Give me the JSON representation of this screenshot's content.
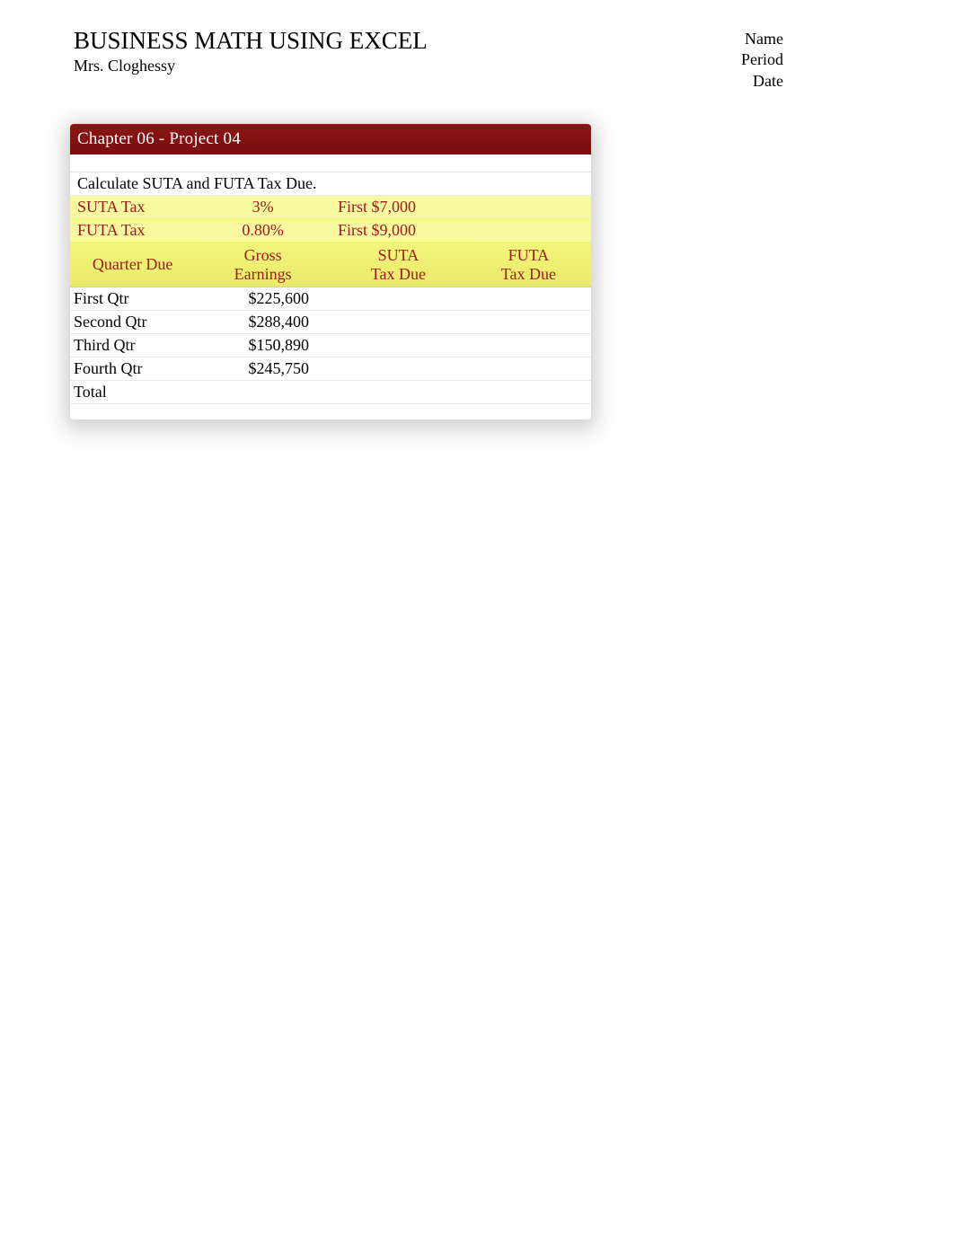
{
  "header": {
    "title": "BUSINESS MATH USING EXCEL",
    "subtitle": "Mrs. Cloghessy"
  },
  "meta": {
    "name": "Name",
    "period": "Period",
    "date": "Date"
  },
  "panel": {
    "title": "Chapter 06 - Project 04",
    "instruction": "Calculate SUTA and FUTA Tax Due.",
    "taxes": [
      {
        "label": "SUTA Tax",
        "rate": "3%",
        "first": "First $7,000"
      },
      {
        "label": "FUTA Tax",
        "rate": "0.80%",
        "first": "First $9,000"
      }
    ],
    "columns": {
      "c1": "Quarter Due",
      "c2_a": "Gross",
      "c2_b": "Earnings",
      "c3_a": "SUTA",
      "c3_b": "Tax Due",
      "c4_a": "FUTA",
      "c4_b": "Tax Due"
    },
    "rows": [
      {
        "q": "First Qtr",
        "gross": "$225,600",
        "suta": "",
        "futa": ""
      },
      {
        "q": "Second Qtr",
        "gross": "$288,400",
        "suta": "",
        "futa": ""
      },
      {
        "q": "Third Qtr",
        "gross": "$150,890",
        "suta": "",
        "futa": ""
      },
      {
        "q": "Fourth Qtr",
        "gross": "$245,750",
        "suta": "",
        "futa": ""
      }
    ],
    "total_label": "Total"
  }
}
